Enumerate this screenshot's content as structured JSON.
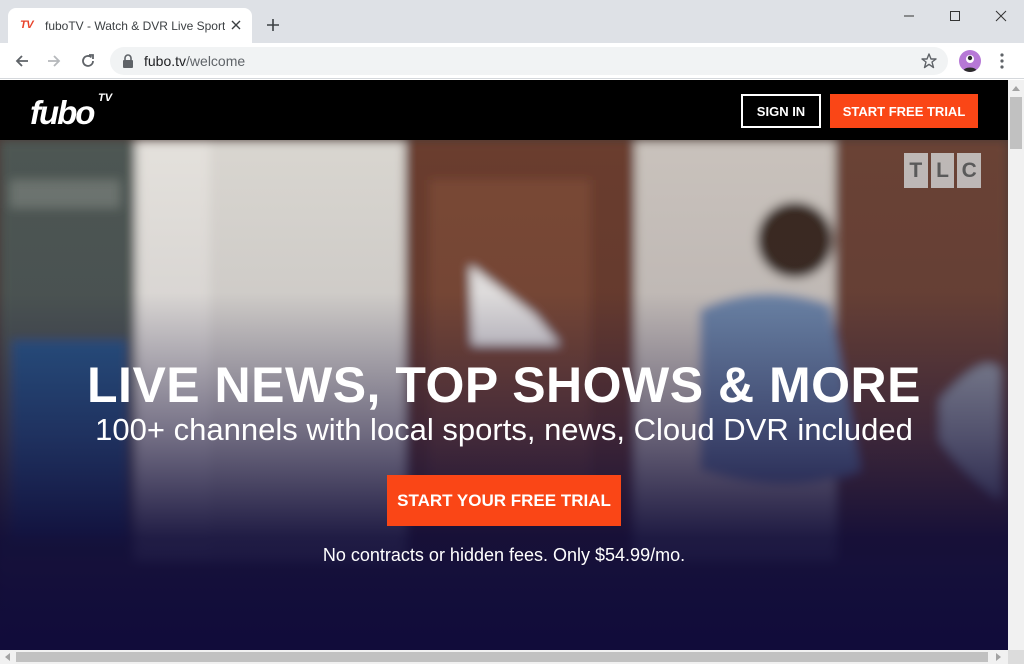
{
  "browser": {
    "tab": {
      "favicon_text": "TV",
      "title": "fuboTV - Watch & DVR Live Sports",
      "close_icon": "close-icon"
    },
    "new_tab_icon": "plus-icon",
    "window_controls": [
      "minimize-icon",
      "maximize-icon",
      "close-icon"
    ],
    "address_bar": {
      "host": "fubo.tv",
      "path": "/welcome",
      "lock_icon": "lock-icon",
      "bookmark_icon": "star-icon"
    },
    "nav_icons": [
      "back-arrow-icon",
      "forward-arrow-icon",
      "reload-icon"
    ],
    "menu_icon": "vertical-dots-icon"
  },
  "site": {
    "logo": {
      "main": "fubo",
      "superscript": "TV"
    },
    "header": {
      "sign_in_label": "SIGN IN",
      "trial_label": "START FREE TRIAL"
    },
    "network_bug": [
      "T",
      "L",
      "C"
    ],
    "hero": {
      "title": "LIVE NEWS, TOP SHOWS & MORE",
      "subtitle": "100+ channels with local sports, news, Cloud DVR included",
      "cta_label": "START YOUR FREE TRIAL",
      "note": "No contracts or hidden fees. Only $54.99/mo."
    }
  },
  "colors": {
    "accent": "#fa4616",
    "header_bg": "#000000",
    "hero_bottom": "#110c3a",
    "tabstrip_bg": "#dee1e6"
  }
}
